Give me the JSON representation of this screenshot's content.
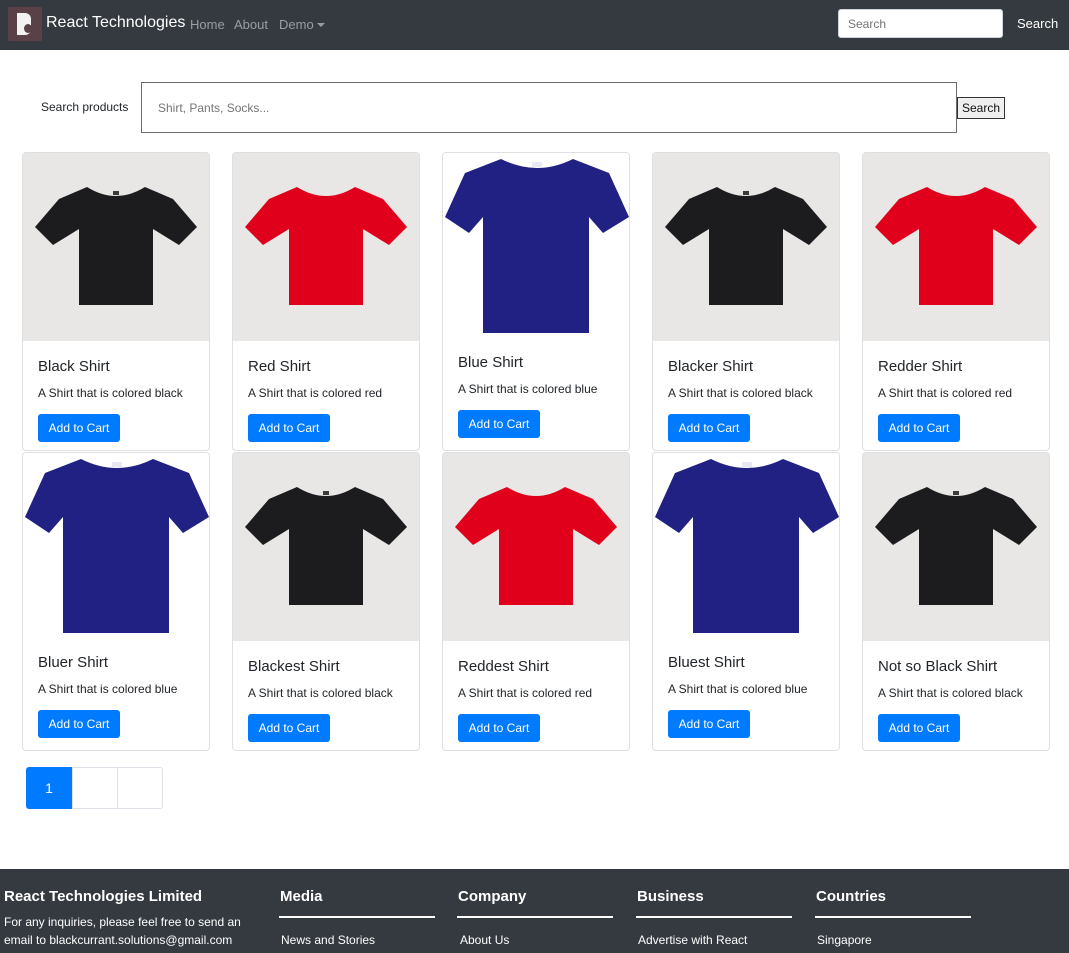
{
  "navbar": {
    "brand": "React Technologies",
    "links": [
      "Home",
      "About",
      "Demo"
    ],
    "search_placeholder": "Search",
    "search_button": "Search"
  },
  "search": {
    "label": "Search products",
    "placeholder": "Shirt, Pants, Socks...",
    "button": "Search"
  },
  "products": [
    {
      "title": "Black Shirt",
      "desc": "A Shirt that is colored black",
      "button": "Add to Cart",
      "color": "black"
    },
    {
      "title": "Red Shirt",
      "desc": "A Shirt that is colored red",
      "button": "Add to Cart",
      "color": "red"
    },
    {
      "title": "Blue Shirt",
      "desc": "A Shirt that is colored blue",
      "button": "Add to Cart",
      "color": "blue"
    },
    {
      "title": "Blacker Shirt",
      "desc": "A Shirt that is colored black",
      "button": "Add to Cart",
      "color": "black"
    },
    {
      "title": "Redder Shirt",
      "desc": "A Shirt that is colored red",
      "button": "Add to Cart",
      "color": "red"
    },
    {
      "title": "Bluer Shirt",
      "desc": "A Shirt that is colored blue",
      "button": "Add to Cart",
      "color": "blue"
    },
    {
      "title": "Blackest Shirt",
      "desc": "A Shirt that is colored black",
      "button": "Add to Cart",
      "color": "black"
    },
    {
      "title": "Reddest Shirt",
      "desc": "A Shirt that is colored red",
      "button": "Add to Cart",
      "color": "red"
    },
    {
      "title": "Bluest Shirt",
      "desc": "A Shirt that is colored blue",
      "button": "Add to Cart",
      "color": "blue"
    },
    {
      "title": "Not so Black Shirt",
      "desc": "A Shirt that is colored black",
      "button": "Add to Cart",
      "color": "black"
    }
  ],
  "pagination": {
    "pages": [
      "1",
      "",
      ""
    ],
    "active_index": 0
  },
  "footer": {
    "company": "React Technologies Limited",
    "inquiry": "For any inquiries, please feel free to send an email to blackcurrant.solutions@gmail.com",
    "columns": [
      {
        "title": "Media",
        "link": "News and Stories"
      },
      {
        "title": "Company",
        "link": "About Us"
      },
      {
        "title": "Business",
        "link": "Advertise with React"
      },
      {
        "title": "Countries",
        "link": "Singapore"
      }
    ]
  },
  "colors": {
    "navbar_bg": "#343a40",
    "primary": "#007bff",
    "shirt_black": "#1c1c1e",
    "shirt_red": "#e0001b",
    "shirt_blue": "#212183"
  }
}
